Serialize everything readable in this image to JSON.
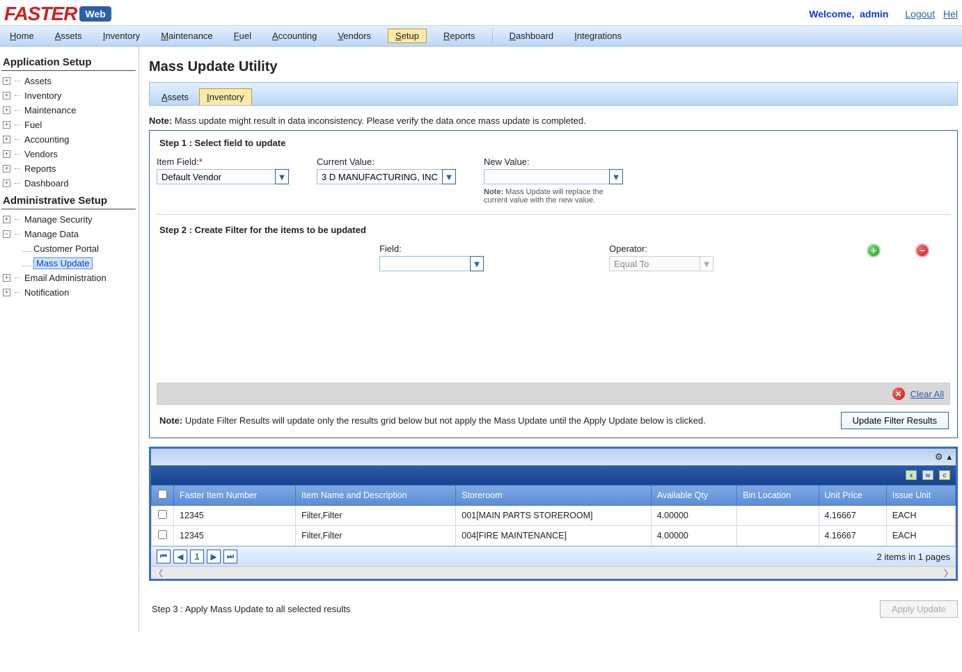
{
  "header": {
    "logo_text": "FASTER",
    "logo_web": "Web",
    "welcome": "Welcome,",
    "user": "admin",
    "logout": "Logout",
    "help": "Hel"
  },
  "mainmenu": [
    {
      "pre": "H",
      "label": "ome"
    },
    {
      "pre": "A",
      "label": "ssets"
    },
    {
      "pre": "I",
      "label": "nventory"
    },
    {
      "pre": "M",
      "label": "aintenance"
    },
    {
      "pre": "F",
      "label": "uel"
    },
    {
      "pre": "A",
      "label": "ccounting"
    },
    {
      "pre": "V",
      "label": "endors"
    },
    {
      "pre": "S",
      "label": "etup",
      "active": true
    },
    {
      "pre": "R",
      "label": "eports"
    },
    {
      "pre": "D",
      "label": "ashboard",
      "sep_before": true
    },
    {
      "pre": "I",
      "label": "ntegrations"
    }
  ],
  "sidebar": {
    "section1": "Application Setup",
    "tree1": [
      "Assets",
      "Inventory",
      "Maintenance",
      "Fuel",
      "Accounting",
      "Vendors",
      "Reports",
      "Dashboard"
    ],
    "section2": "Administrative Setup",
    "tree2a": "Manage Security",
    "tree2b": "Manage Data",
    "tree2b_children": [
      "Customer Portal",
      "Mass Update"
    ],
    "tree2c": "Email Administration",
    "tree2d": "Notification",
    "selected": "Mass Update"
  },
  "page": {
    "title": "Mass Update Utility",
    "tabs": [
      {
        "pre": "A",
        "label": "ssets"
      },
      {
        "pre": "I",
        "label": "nventory",
        "active": true
      }
    ],
    "note1_b": "Note:",
    "note1": " Mass update might result in data inconsistency. Please verify the data once mass update is completed.",
    "step1_title": "Step 1 : Select field to update",
    "item_field_label": "Item Field:",
    "item_field_value": "Default Vendor",
    "current_value_label": "Current Value:",
    "current_value": "3 D MANUFACTURING, INC",
    "new_value_label": "New Value:",
    "new_value": "",
    "new_value_note_b": "Note:",
    "new_value_note": " Mass Update will replace the current value with the new value.",
    "step2_title": "Step 2 : Create Filter for the items to be updated",
    "filter_field_label": "Field:",
    "filter_field_value": "",
    "filter_operator_label": "Operator:",
    "filter_operator_value": "Equal To",
    "clear_all": "Clear All",
    "note2_b": "Note:",
    "note2": " Update Filter Results will update only the results grid below but not apply the Mass Update until the Apply Update below is clicked.",
    "update_filter_btn": "Update Filter Results",
    "step3_title": "Step 3 : Apply Mass Update to all selected results",
    "apply_btn": "Apply Update"
  },
  "grid": {
    "headers": [
      "",
      "Faster Item Number",
      "Item Name and Description",
      "Storeroom",
      "Available Qty",
      "Bin Location",
      "Unit Price",
      "Issue Unit"
    ],
    "rows": [
      {
        "num": "12345",
        "desc": "Filter,Filter",
        "store": "001[MAIN PARTS STOREROOM]",
        "qty": "4.00000",
        "bin": "",
        "price": "4.16667",
        "unit": "EACH"
      },
      {
        "num": "12345",
        "desc": "Filter,Filter",
        "store": "004[FIRE MAINTENANCE]",
        "qty": "4.00000",
        "bin": "",
        "price": "4.16667",
        "unit": "EACH"
      }
    ],
    "pager_status": "2 items in 1 pages"
  }
}
